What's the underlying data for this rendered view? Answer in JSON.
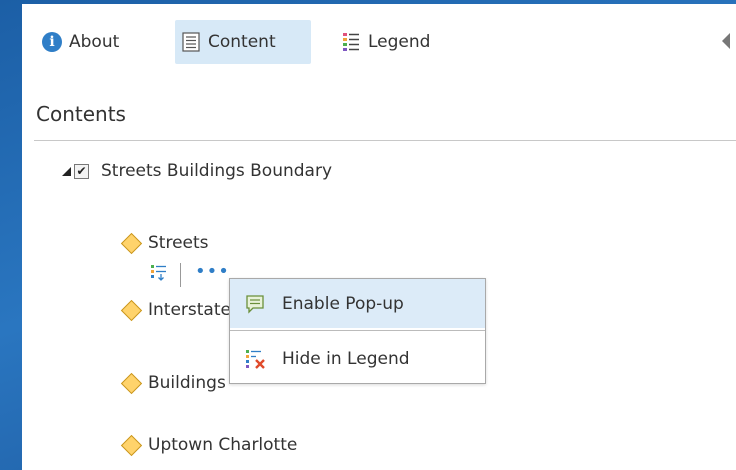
{
  "tabs": [
    {
      "label": "About",
      "icon": "info-icon",
      "active": false
    },
    {
      "label": "Content",
      "icon": "content-list-icon",
      "active": true
    },
    {
      "label": "Legend",
      "icon": "legend-icon",
      "active": false
    }
  ],
  "section_title": "Contents",
  "group": {
    "label": "Streets Buildings Boundary",
    "checked": true
  },
  "layers": [
    {
      "label": "Streets"
    },
    {
      "label": "Interstates"
    },
    {
      "label": "Buildings"
    },
    {
      "label": "Uptown Charlotte"
    }
  ],
  "context_menu": {
    "items": [
      {
        "label": "Enable Pop-up",
        "icon": "popup-icon"
      },
      {
        "label": "Hide in Legend",
        "icon": "hide-legend-icon"
      }
    ]
  },
  "colors": {
    "accent": "#2f7ec7",
    "active_tab": "#d7e9f7",
    "layer_symbol": "#ffd36b",
    "background": "#2a76c0"
  }
}
